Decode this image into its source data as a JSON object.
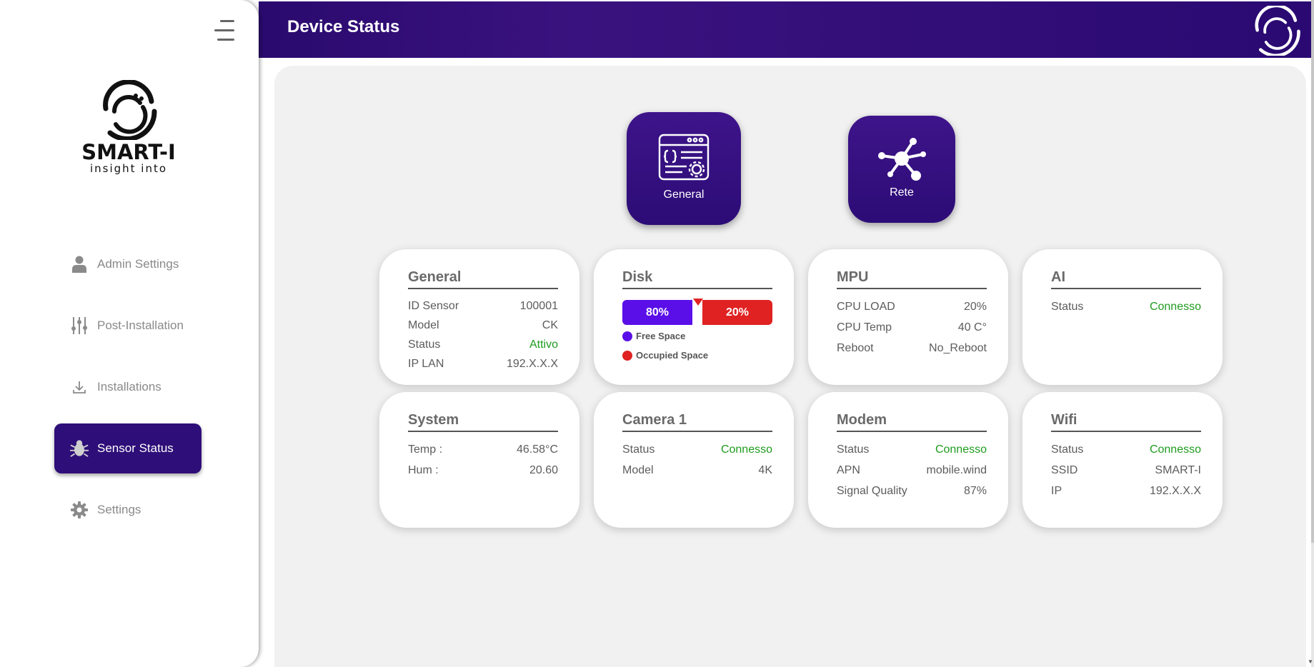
{
  "sidebar": {
    "brand": {
      "name": "SMART-I",
      "tagline": "insight into"
    },
    "items": [
      {
        "label": "Admin Settings",
        "icon": "user-icon"
      },
      {
        "label": "Post-Installation",
        "icon": "sliders-icon"
      },
      {
        "label": "Installations",
        "icon": "download-icon"
      },
      {
        "label": "Sensor Status",
        "icon": "bug-icon",
        "active": true
      },
      {
        "label": "Settings",
        "icon": "gear-icon"
      }
    ]
  },
  "header": {
    "title": "Device Status"
  },
  "buttons": {
    "general": {
      "label": "General",
      "icon": "app-settings-icon"
    },
    "rete": {
      "label": "Rete",
      "icon": "network-icon"
    }
  },
  "cards": {
    "general": {
      "title": "General",
      "rows": [
        {
          "label": "ID Sensor",
          "value": "100001"
        },
        {
          "label": "Model",
          "value": "CK"
        },
        {
          "label": "Status",
          "value": "Attivo"
        },
        {
          "label": "IP LAN",
          "value": "192.X.X.X"
        }
      ]
    },
    "disk": {
      "title": "Disk",
      "free_value": "80%",
      "occupied_value": "20%",
      "legend_free": "Free Space",
      "legend_occupied": "Occupied Space"
    },
    "mpu": {
      "title": "MPU",
      "rows": [
        {
          "label": "CPU LOAD",
          "value": "20%"
        },
        {
          "label": "CPU Temp",
          "value": "40 C°"
        },
        {
          "label": "Reboot",
          "value": "No_Reboot"
        }
      ]
    },
    "ai": {
      "title": "AI",
      "rows": [
        {
          "label": "Status",
          "value": "Connesso"
        }
      ]
    },
    "system": {
      "title": "System",
      "rows": [
        {
          "label": "Temp :",
          "value": "46.58°C"
        },
        {
          "label": "Hum :",
          "value": "20.60"
        }
      ]
    },
    "camera": {
      "title": "Camera 1",
      "rows": [
        {
          "label": "Status",
          "value": "Connesso"
        },
        {
          "label": "Model",
          "value": "4K"
        }
      ]
    },
    "modem": {
      "title": "Modem",
      "rows": [
        {
          "label": "Status",
          "value": "Connesso"
        },
        {
          "label": "APN",
          "value": "mobile.wind"
        },
        {
          "label": "Signal Quality",
          "value": "87%"
        }
      ]
    },
    "wifi": {
      "title": "Wifi",
      "rows": [
        {
          "label": "Status",
          "value": "Connesso"
        },
        {
          "label": "SSID",
          "value": "SMART-I"
        },
        {
          "label": "IP",
          "value": "192.X.X.X"
        }
      ]
    }
  },
  "colors": {
    "primary": "#2e0e78",
    "status_ok": "#1f9b1f",
    "disk_free": "#5a0fe8",
    "disk_occupied": "#e02222"
  }
}
